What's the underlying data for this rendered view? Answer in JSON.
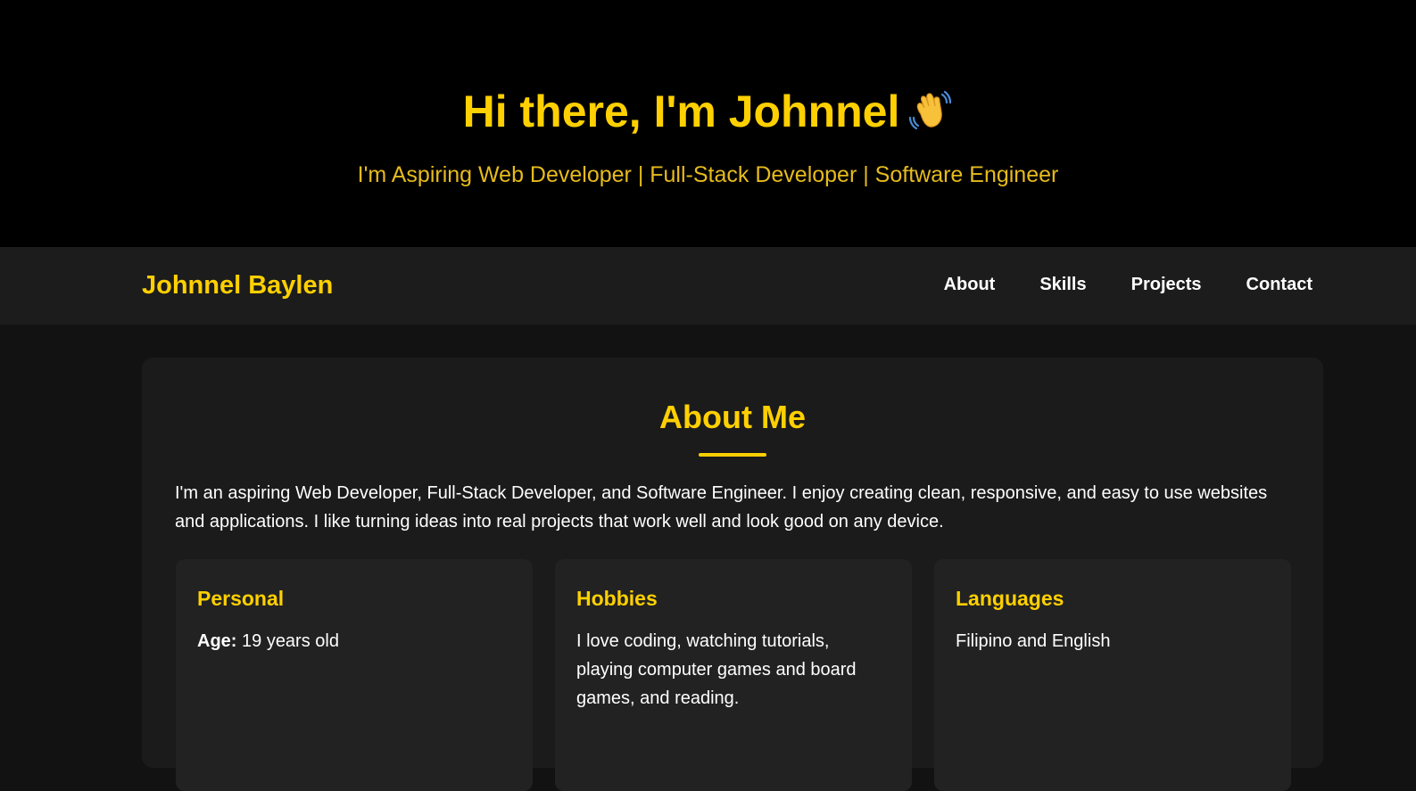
{
  "hero": {
    "title": "Hi there, I'm Johnnel",
    "wave_icon": "waving-hand-icon",
    "subtitle": "I'm Aspiring Web Developer | Full-Stack Developer | Software Engineer"
  },
  "navbar": {
    "brand": "Johnnel Baylen",
    "links": [
      "About",
      "Skills",
      "Projects",
      "Contact"
    ]
  },
  "about": {
    "title": "About Me",
    "text": "I'm an aspiring Web Developer, Full-Stack Developer, and Software Engineer. I enjoy creating clean, responsive, and easy to use websites and applications. I like turning ideas into real projects that work well and look good on any device.",
    "cards": {
      "personal": {
        "title": "Personal",
        "age_label": "Age:",
        "age_value": " 19 years old"
      },
      "hobbies": {
        "title": "Hobbies",
        "text": "I love coding, watching tutorials, playing computer games and board games, and reading."
      },
      "languages": {
        "title": "Languages",
        "text": "Filipino and English"
      }
    }
  },
  "colors": {
    "accent": "#FFD000",
    "hero_bg": "#000000",
    "nav_bg": "#1C1C1C",
    "page_bg": "#121212",
    "card_bg": "#1B1B1B",
    "info_card_bg": "#222222"
  }
}
